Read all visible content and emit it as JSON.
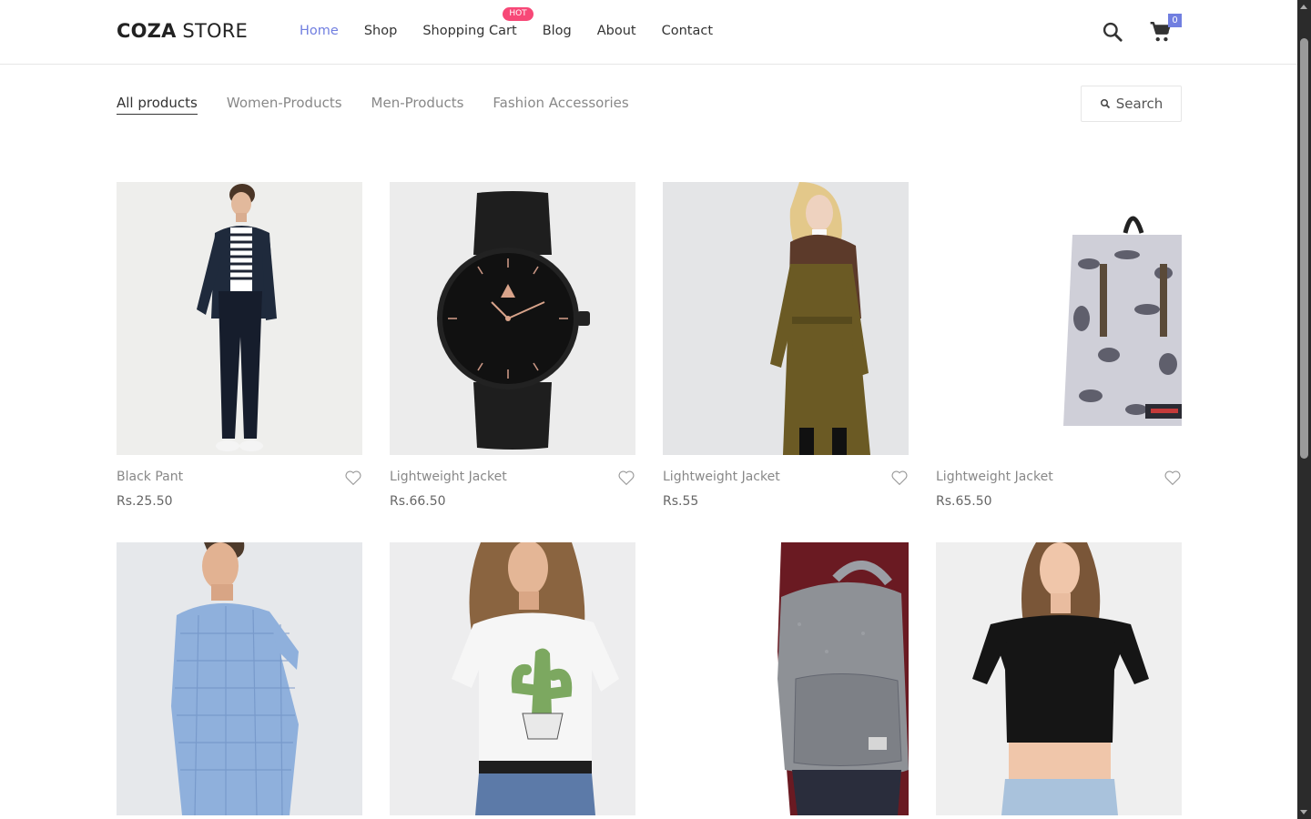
{
  "header": {
    "logo_bold": "COZA",
    "logo_light": " STORE",
    "nav": [
      {
        "label": "Home",
        "active": true
      },
      {
        "label": "Shop"
      },
      {
        "label": "Shopping Cart",
        "badge": "HOT"
      },
      {
        "label": "Blog"
      },
      {
        "label": "About"
      },
      {
        "label": "Contact"
      }
    ],
    "cart_count": "0"
  },
  "filters": {
    "items": [
      "All products",
      "Women-Products",
      "Men-Products",
      "Fashion Accessories"
    ],
    "active": "All products",
    "search_label": "Search"
  },
  "products": [
    {
      "name": "Black Pant",
      "price": "Rs.25.50",
      "image": "man-jacket-pants"
    },
    {
      "name": "Lightweight Jacket",
      "price": "Rs.66.50",
      "image": "black-watch"
    },
    {
      "name": "Lightweight Jacket",
      "price": "Rs.55",
      "image": "woman-olive-coat"
    },
    {
      "name": "Lightweight Jacket",
      "price": "Rs.65.50",
      "image": "patterned-backpack"
    },
    {
      "name": "",
      "price": "",
      "image": "man-blue-shirt"
    },
    {
      "name": "",
      "price": "",
      "image": "woman-cactus-tee"
    },
    {
      "name": "",
      "price": "",
      "image": "grey-backpack"
    },
    {
      "name": "",
      "price": "",
      "image": "woman-black-crop-top"
    }
  ],
  "colors": {
    "accent": "#717fe0",
    "hot": "#f74877"
  }
}
